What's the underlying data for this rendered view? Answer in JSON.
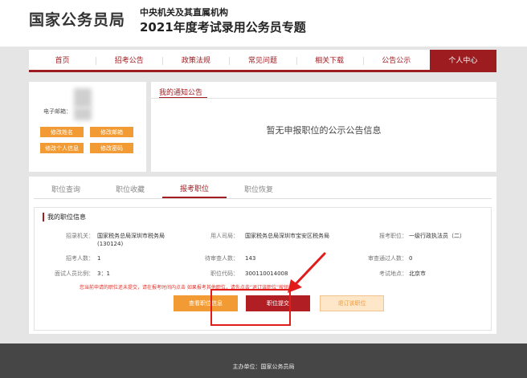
{
  "header": {
    "logo": "国家公务员局",
    "subtitle_line1": "中央机关及其直属机构",
    "subtitle_line2": "2021年度考试录用公务员专题"
  },
  "nav": {
    "items": [
      {
        "label": "首页"
      },
      {
        "label": "招考公告"
      },
      {
        "label": "政策法规"
      },
      {
        "label": "常见问题"
      },
      {
        "label": "相关下载"
      },
      {
        "label": "公告公示"
      },
      {
        "label": "个人中心",
        "active": true
      }
    ]
  },
  "profile": {
    "email_label": "电子邮箱：",
    "buttons": {
      "edit_name": "修改姓名",
      "edit_email": "修改邮箱",
      "edit_info": "修改个人信息",
      "edit_password": "修改密码"
    }
  },
  "notice": {
    "title": "我的通知公告",
    "empty": "暂无申报职位的公示公告信息"
  },
  "tabs": [
    {
      "label": "职位查询"
    },
    {
      "label": "职位收藏"
    },
    {
      "label": "报考职位",
      "active": true
    },
    {
      "label": "职位恢复"
    }
  ],
  "job": {
    "section_title": "我的职位信息",
    "fields": {
      "recruiting_org_label": "招录机关：",
      "recruiting_org_value": "国家税务总局深圳市税务局(130124)",
      "employer_label": "用人司局：",
      "employer_value": "国家税务总局深圳市宝安区税务局",
      "position_label": "报考职位：",
      "position_value": "一级行政执法员（二）",
      "quota_label": "招考人数：",
      "quota_value": "1",
      "pending_label": "待审查人数：",
      "pending_value": "143",
      "approved_label": "审查通过人数：",
      "approved_value": "0",
      "ratio_label": "面试人员比例：",
      "ratio_value": "3：1",
      "code_label": "职位代码：",
      "code_value": "300110014008",
      "location_label": "考试地点：",
      "location_value": "北京市"
    },
    "warning": "您当前申请的职位还未提交，请在报考时间内点击   如果报考其他职位，请先点击“退订该职位”按钮。",
    "buttons": {
      "view": "查看职位信息",
      "submit": "职位提交",
      "unsubscribe": "退订该职位"
    }
  },
  "footer": {
    "text": "主办单位：国家公务员局"
  },
  "colors": {
    "brand_red": "#9c1c20",
    "orange": "#f29b34",
    "warning_red": "#e0332b",
    "annotation_red": "#e21b1b"
  }
}
